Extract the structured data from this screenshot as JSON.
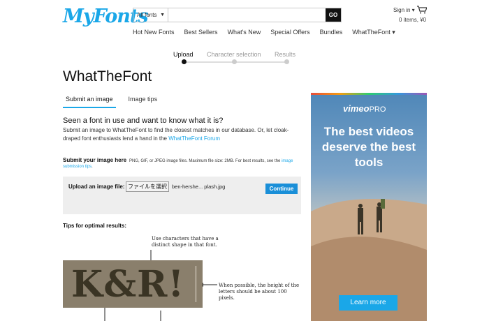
{
  "header": {
    "logo": "MyFonts",
    "search_category": "All fonts",
    "search_placeholder": "",
    "go_label": "GO",
    "signin": "Sign in ▾",
    "cart_summary": "0 items, ¥0"
  },
  "nav": [
    "Hot New Fonts",
    "Best Sellers",
    "What's New",
    "Special Offers",
    "Bundles",
    "WhatTheFont ▾"
  ],
  "steps": [
    {
      "label": "Upload",
      "active": true
    },
    {
      "label": "Character selection",
      "active": false
    },
    {
      "label": "Results",
      "active": false
    }
  ],
  "page_title": "WhatTheFont",
  "tabs": [
    "Submit an image",
    "Image tips"
  ],
  "question": "Seen a font in use and want to know what it is?",
  "intro": "Submit an image to WhatTheFont to find the closest matches in our database. Or, let cloak-draped font enthusiasts lend a hand in the",
  "intro_link": "WhatTheFont Forum",
  "submit": {
    "heading": "Submit your image here",
    "note": "PNG, GIF, or JPEG image files. Maximum file size: 2MB. For best results, see the",
    "note_link_a": "image",
    "note_link_b": "submission tips",
    "note_end": "."
  },
  "upload": {
    "label": "Upload an image file:",
    "file_button": "ファイルを選択",
    "file_name": "ben-hershe... plash.jpg",
    "continue_label": "Continue"
  },
  "tips": {
    "heading": "Tips for optimal results:",
    "annotation_1": "Use characters that have a distinct shape in that font.",
    "annotation_2": "When possible, the height of the letters should be about 100 pixels.",
    "sample_text": "K&R!"
  },
  "ad": {
    "logo_a": "vimeo",
    "logo_b": "PRO",
    "headline": "The best videos deserve the best tools",
    "cta": "Learn more"
  }
}
